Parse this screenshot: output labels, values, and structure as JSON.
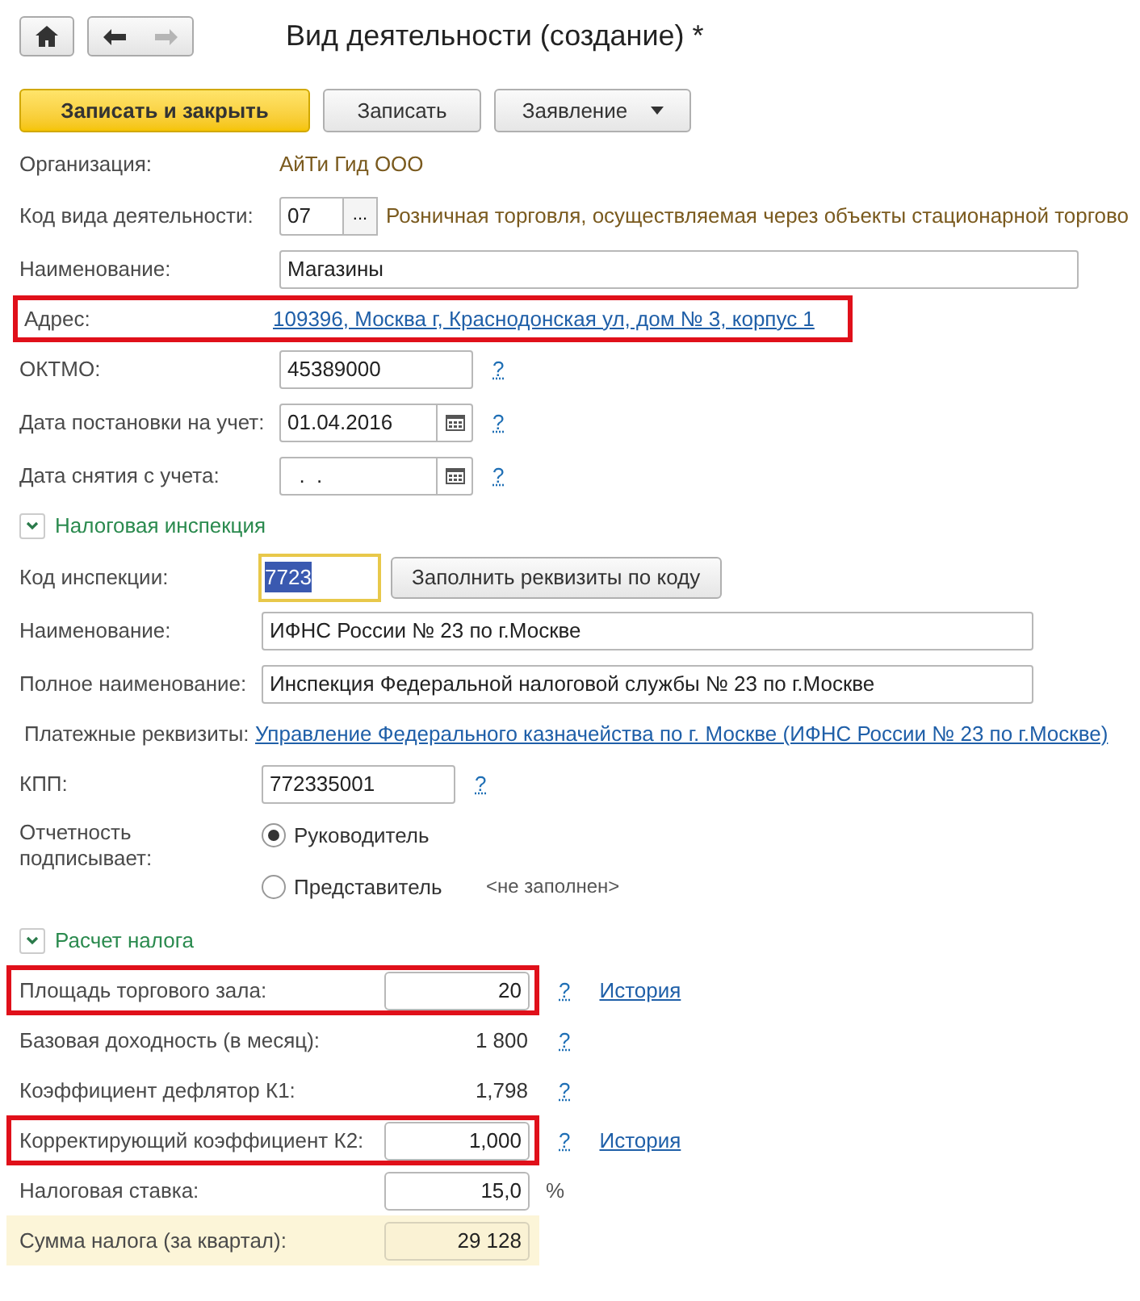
{
  "nav": [
    {
      "kind": "home",
      "disabled": false
    },
    {
      "kind": "back",
      "disabled": false
    },
    {
      "kind": "forward",
      "disabled": true
    }
  ],
  "title": "Вид деятельности (создание) *",
  "actions": [
    {
      "label": "Записать и закрыть",
      "kind": "primary"
    },
    {
      "label": "Записать",
      "kind": "default"
    },
    {
      "label": "Заявление",
      "kind": "dropdown"
    }
  ],
  "main": [
    {
      "kind": "static",
      "label": "Организация:",
      "value": "АйТи Гид ООО"
    },
    {
      "kind": "code",
      "label": "Код вида деятельности:",
      "value": "07",
      "button": "...",
      "description": "Розничная торговля, осуществляемая через объекты стационарной торгово"
    },
    {
      "kind": "input",
      "label": "Наименование:",
      "value": "Магазины"
    },
    {
      "kind": "link",
      "label": "Адрес:",
      "value": "109396, Москва г, Краснодонская ул, дом № 3, корпус 1",
      "highlighted": true
    },
    {
      "kind": "input",
      "label": "ОКТМО:",
      "value": "45389000",
      "help": "?"
    },
    {
      "kind": "date",
      "label": "Дата постановки на учет:",
      "value": "01.04.2016",
      "help": "?"
    },
    {
      "kind": "date",
      "label": "Дата снятия с учета:",
      "value": "  .  .",
      "help": "?"
    }
  ],
  "sections": [
    {
      "title": "Налоговая инспекция",
      "expanded": true,
      "rows": [
        {
          "kind": "focused",
          "label": "Код инспекции:",
          "value": "7723",
          "focused": true,
          "button": "Заполнить реквизиты по коду"
        },
        {
          "kind": "input",
          "label": "Наименование:",
          "value": "ИФНС России № 23 по г.Москве"
        },
        {
          "kind": "input",
          "label": "Полное наименование:",
          "value": "Инспекция Федеральной налоговой службы № 23 по г.Москве"
        },
        {
          "kind": "link",
          "label": "Платежные реквизиты:",
          "value": "Управление Федерального казначейства по г. Москве (ИФНС России № 23 по г.Москве)",
          "highlighted": false
        },
        {
          "kind": "input",
          "label": "КПП:",
          "value": "772335001",
          "help": "?"
        },
        {
          "kind": "radio",
          "label": "Отчетность подписывает:",
          "options": [
            {
              "label": "Руководитель",
              "selected": true
            },
            {
              "label": "Представитель",
              "selected": false,
              "note": "<не заполнен>"
            }
          ]
        }
      ]
    },
    {
      "title": "Расчет налога",
      "expanded": true,
      "rows": [
        {
          "kind": "calc_input",
          "label": "Площадь торгового зала:",
          "value": "20",
          "help": "?",
          "link": "История",
          "highlighted": true
        },
        {
          "kind": "calc_value",
          "label": "Базовая доходность (в месяц):",
          "value": "1 800",
          "help": "?"
        },
        {
          "kind": "calc_value",
          "label": "Коэффициент дефлятор К1:",
          "value": "1,798",
          "help": "?"
        },
        {
          "kind": "calc_input",
          "label": "Корректирующий коэффициент К2:",
          "value": "1,000",
          "help": "?",
          "link": "История",
          "highlighted": true
        },
        {
          "kind": "calc_unit",
          "label": "Налоговая ставка:",
          "value": "15,0",
          "unit": "%"
        },
        {
          "kind": "total",
          "label": "Сумма налога (за квартал):",
          "value": "29 128"
        }
      ]
    }
  ]
}
